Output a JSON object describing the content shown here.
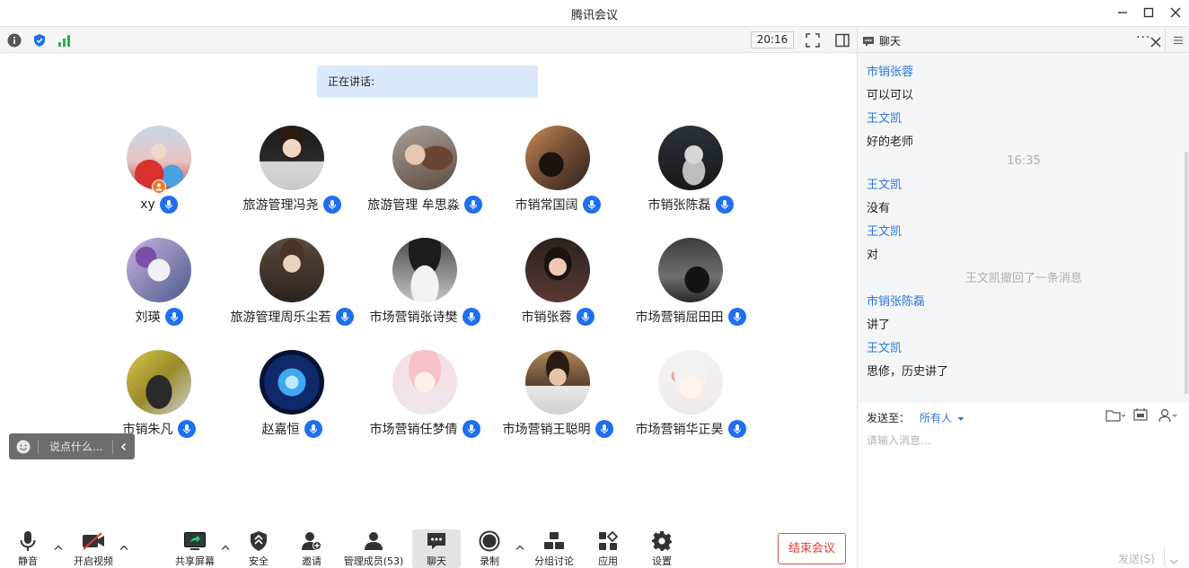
{
  "window": {
    "title": "腾讯会议"
  },
  "top_toolbar": {
    "clock": "20:16"
  },
  "meeting": {
    "speaking_label": "正在讲话:"
  },
  "participants": [
    {
      "name": "xy"
    },
    {
      "name": "旅游管理冯尧"
    },
    {
      "name": "旅游管理 牟思淼"
    },
    {
      "name": "市销常国阔"
    },
    {
      "name": "市销张陈磊"
    },
    {
      "name": "刘瑛"
    },
    {
      "name": "旅游管理周乐尘若"
    },
    {
      "name": "市场营销张诗樊"
    },
    {
      "name": "市销张蓉"
    },
    {
      "name": "市场营销屈田田"
    },
    {
      "name": "市销朱凡"
    },
    {
      "name": "赵嘉恒"
    },
    {
      "name": "市场营销任梦倩"
    },
    {
      "name": "市场营销王聪明"
    },
    {
      "name": "市场营销华正昊"
    }
  ],
  "quick_chat": {
    "placeholder": "说点什么..."
  },
  "toolbar": {
    "mute": "静音",
    "video": "开启视频",
    "share": "共享屏幕",
    "security": "安全",
    "invite": "邀请",
    "members": "管理成员(53)",
    "chat": "聊天",
    "record": "录制",
    "breakout": "分组讨论",
    "apps": "应用",
    "settings": "设置",
    "end_meeting": "结束会议"
  },
  "chat": {
    "title": "聊天",
    "messages": [
      {
        "kind": "sender",
        "text": "市销张蓉"
      },
      {
        "kind": "body",
        "text": "可以可以"
      },
      {
        "kind": "sender",
        "text": "王文凯"
      },
      {
        "kind": "body",
        "text": "好的老师"
      },
      {
        "kind": "center",
        "text": "16:35"
      },
      {
        "kind": "sender",
        "text": "王文凯"
      },
      {
        "kind": "body",
        "text": "没有"
      },
      {
        "kind": "sender",
        "text": "王文凯"
      },
      {
        "kind": "body",
        "text": "对"
      },
      {
        "kind": "center",
        "text": "王文凯撤回了一条消息"
      },
      {
        "kind": "sender",
        "text": "市销张陈磊"
      },
      {
        "kind": "body",
        "text": "讲了"
      },
      {
        "kind": "sender",
        "text": "王文凯"
      },
      {
        "kind": "body",
        "text": "思修，历史讲了"
      }
    ],
    "send_to_label": "发送至：",
    "send_target": "所有人",
    "input_placeholder": "请输入消息...",
    "send_button": "发送(S)"
  }
}
